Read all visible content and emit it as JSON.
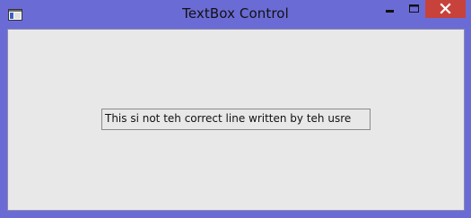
{
  "window": {
    "title": "TextBox Control",
    "icons": {
      "app": "window-app-icon",
      "minimize": "minimize-icon",
      "maximize": "maximize-icon",
      "close": "close-icon"
    },
    "colors": {
      "frame": "#6b6bd6",
      "close_button": "#c7423a",
      "client_background": "#e8e8e8"
    }
  },
  "textbox": {
    "value": "This si not teh correct line written by teh usre"
  }
}
